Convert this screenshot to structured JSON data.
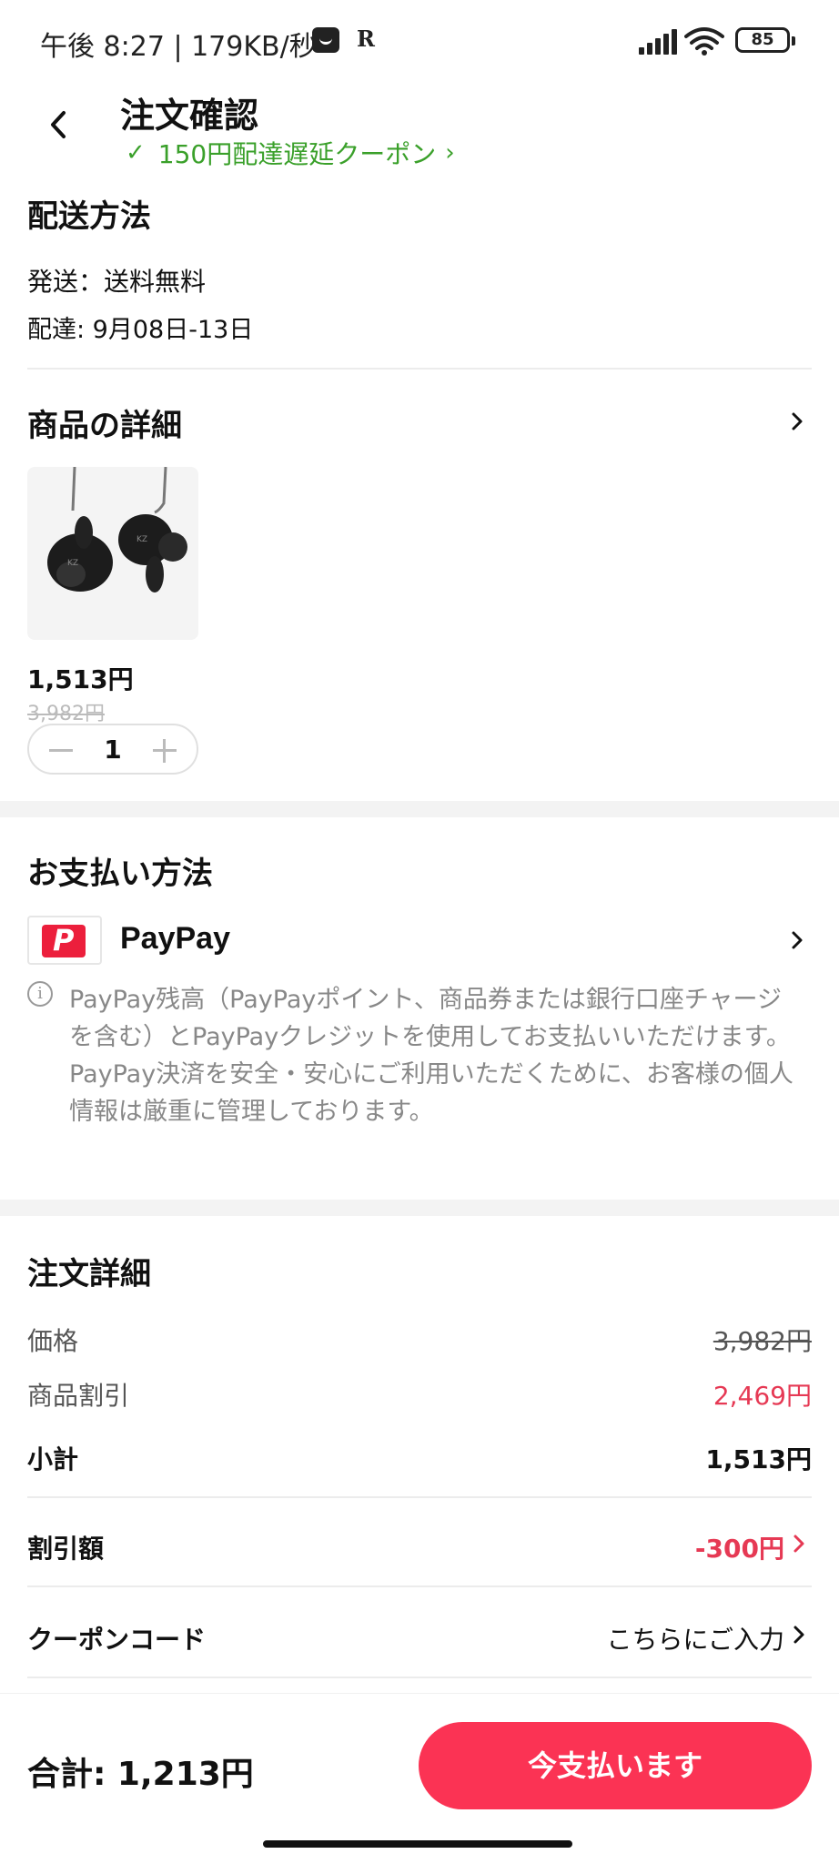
{
  "status_bar": {
    "time": "午後 8:27 | 179KB/秒",
    "battery": "85",
    "signal_icon": "signal-icon",
    "wifi_icon": "wifi-icon"
  },
  "header": {
    "title": "注文確認",
    "coupon_label": "150円配達遅延クーポン",
    "back_icon": "chevron-left-icon"
  },
  "shipping": {
    "title": "配送方法",
    "method": "発送：送料無料",
    "delivery": "配達: 9月08日-13日"
  },
  "product": {
    "title": "商品の詳細",
    "image_icon": "earphones-product-image",
    "price": "1,513円",
    "original_price": "3,982円",
    "quantity": "1"
  },
  "payment": {
    "title": "お支払い方法",
    "method": "PayPay",
    "note_1": "PayPay残高（PayPayポイント、商品券または銀行口座チャージを含む）とPayPayクレジットを使用してお支払いいただけます。",
    "note_2": "PayPay決済を安全・安心にご利用いただくために、お客様の個人情報は厳重に管理しております。"
  },
  "order_details": {
    "title": "注文詳細",
    "price_label": "価格",
    "price_value": "3,982円",
    "discount_label": "商品割引",
    "discount_value": "2,469円",
    "subtotal_label": "小計",
    "subtotal_value": "1,513円",
    "reduction_label": "割引額",
    "reduction_value": "-300円",
    "coupon_code_label": "クーポンコード",
    "coupon_code_value": "こちらにご入力"
  },
  "footer": {
    "total": "合計:  1,213円",
    "pay_button": "今支払います"
  },
  "colors": {
    "accent_red": "#fb3354",
    "discount_red": "#e63954",
    "coupon_green": "#3aa02a",
    "paypay_red": "#ec1f3c"
  }
}
